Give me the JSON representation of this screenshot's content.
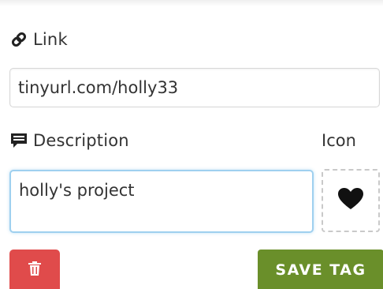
{
  "link": {
    "label": "Link",
    "icon": "link-icon",
    "value": "tinyurl.com/holly33"
  },
  "description": {
    "label": "Description",
    "icon": "comment-icon",
    "value": "holly's project"
  },
  "icon_picker": {
    "label": "Icon",
    "selected_icon": "heart-icon"
  },
  "actions": {
    "delete_icon": "trash-icon",
    "save_label": "SAVE TAG"
  },
  "colors": {
    "delete": "#e04b4b",
    "save": "#6a8f2a",
    "focus_border": "#9fd0ef"
  }
}
